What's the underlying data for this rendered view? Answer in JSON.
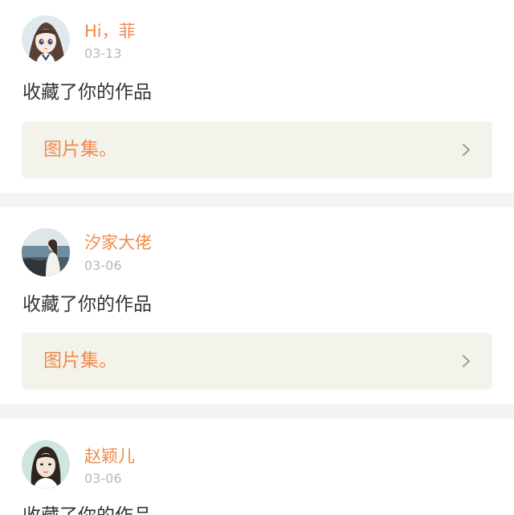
{
  "notifications": [
    {
      "user_name": "Hi，菲",
      "date": "03-13",
      "action_text": "收藏了你的作品",
      "work_title": "图片集。",
      "avatar_icon": "anime-girl-avatar"
    },
    {
      "user_name": "汐家大佬",
      "date": "03-06",
      "action_text": "收藏了你的作品",
      "work_title": "图片集。",
      "avatar_icon": "seaside-girl-avatar"
    },
    {
      "user_name": "赵颖儿",
      "date": "03-06",
      "action_text": "收藏了你的作品",
      "avatar_icon": "portrait-girl-avatar"
    }
  ],
  "colors": {
    "accent": "#f08a4b",
    "date_gray": "#b8b8b8",
    "text": "#333333",
    "work_bg": "#f3f3eb",
    "page_bg": "#f3f3f3"
  }
}
